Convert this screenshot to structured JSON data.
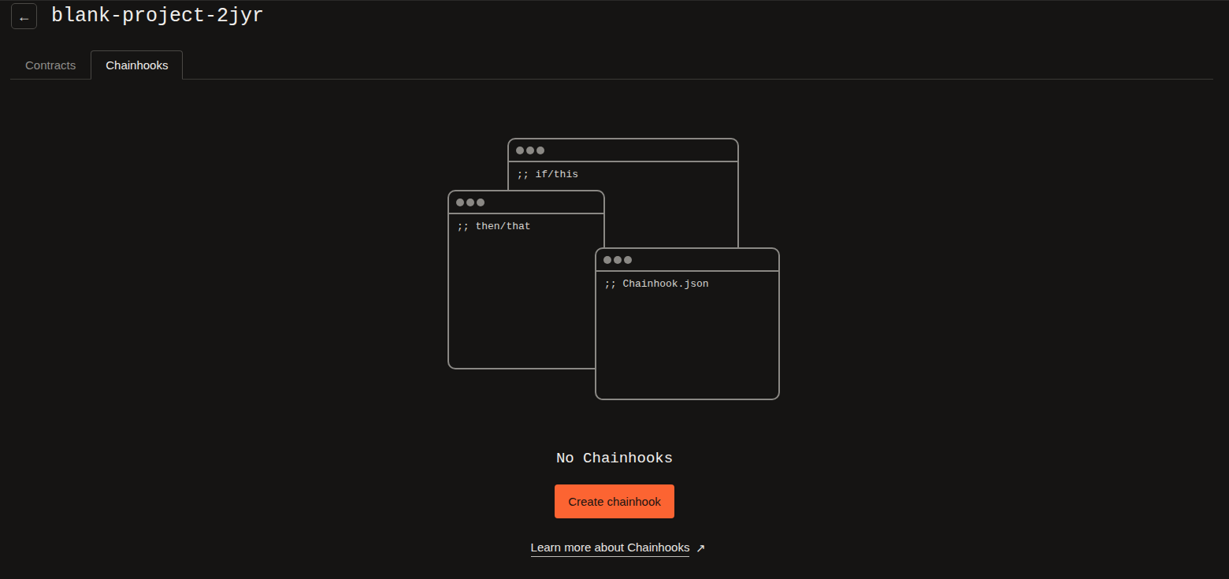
{
  "header": {
    "back_icon": "←",
    "title": "blank-project-2jyr"
  },
  "tabs": [
    {
      "label": "Contracts",
      "selected": false
    },
    {
      "label": "Chainhooks",
      "selected": true
    }
  ],
  "illustration": {
    "windows": [
      {
        "code": ";; if/this"
      },
      {
        "code": ";; then/that"
      },
      {
        "code": ";; Chainhook.json"
      }
    ]
  },
  "empty_state": {
    "title": "No Chainhooks",
    "button": "Create chainhook",
    "link": "Learn more about Chainhooks",
    "link_icon": "↗"
  }
}
